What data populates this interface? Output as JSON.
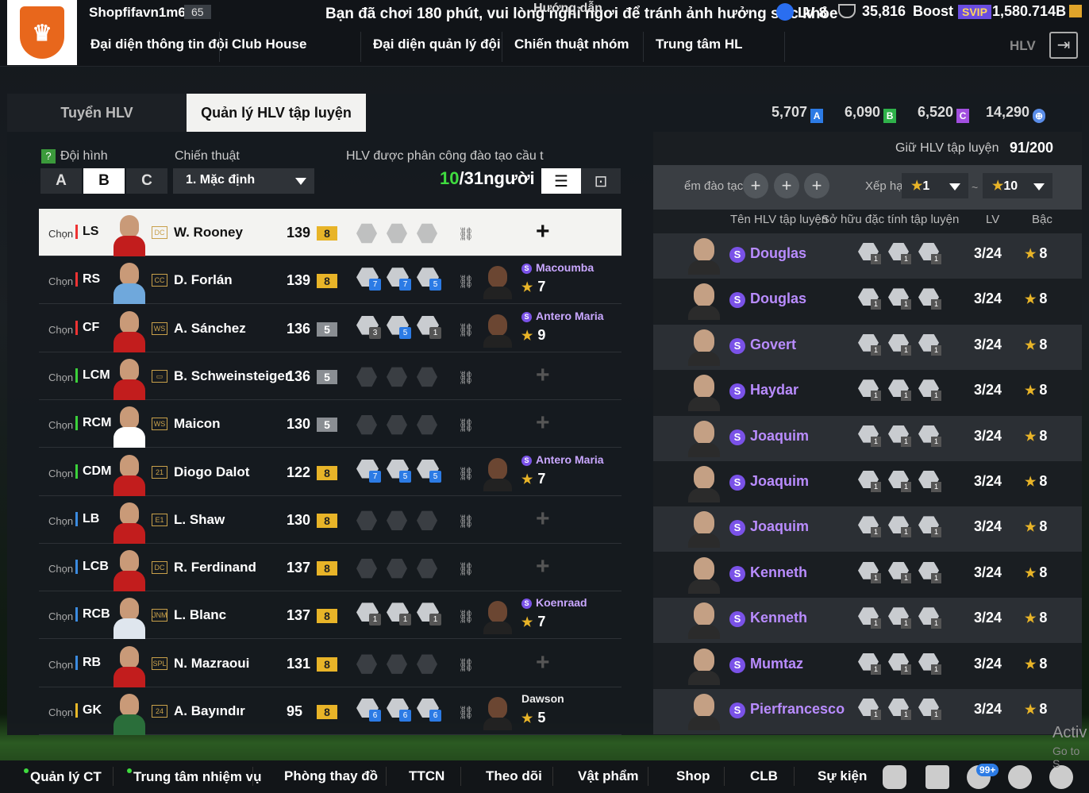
{
  "top": {
    "username": "Shopfifavn1m6",
    "user_level": "65",
    "notice": "Bạn đã chơi 180 phút, vui lòng nghỉ ngơi để tránh ảnh hưởng sức khỏe",
    "guide": "Hướng dẫn",
    "lv": "LV 8",
    "rank_points": "35,816",
    "boost": "Boost",
    "vip": "SVIP",
    "coins": "1,580.714B",
    "hlv": "HLV",
    "crest": "♛"
  },
  "nav": [
    "Đại diện thông tin đội",
    "Club House",
    "Đại diện quản lý đội",
    "Chiến thuật nhóm",
    "Trung tâm HL"
  ],
  "tabs": {
    "recruit": "Tuyển HLV",
    "manage": "Quản lý HLV tập luyện"
  },
  "currencies": [
    {
      "value": "5,707",
      "badge": "A",
      "color": "#2c7be5"
    },
    {
      "value": "6,090",
      "badge": "B",
      "color": "#2fb24a"
    },
    {
      "value": "6,520",
      "badge": "C",
      "color": "#a24fe0"
    },
    {
      "value": "14,290",
      "badge": "⊕",
      "color": "#5a8de8"
    }
  ],
  "left": {
    "squad_label": "Đội hình",
    "q": "?",
    "squads": [
      "A",
      "B",
      "C"
    ],
    "selected_squad": "B",
    "tactic_label": "Chiến thuật",
    "tactic_value": "1. Mặc định",
    "assigned_label": "HLV được phân công đào tạo cầu t",
    "assigned_count": "10",
    "assigned_total": "/31người",
    "list_icon": "list-icon",
    "pitch_icon": "pitch-icon"
  },
  "rows": [
    {
      "chon": "Chọn",
      "pos": "LS",
      "grp": "att",
      "badge": "DC",
      "name": "W. Rooney",
      "ovr": "139",
      "lvl": "8",
      "lvlc": "gold",
      "skills": [],
      "coach": null,
      "hl": true
    },
    {
      "chon": "Chọn",
      "pos": "RS",
      "grp": "att",
      "badge": "CC",
      "name": "D. Forlán",
      "ovr": "139",
      "lvl": "8",
      "lvlc": "gold",
      "skills": [
        "7",
        "7",
        "5"
      ],
      "coach": {
        "name": "Macoumba",
        "stars": "7",
        "s": true
      }
    },
    {
      "chon": "Chọn",
      "pos": "CF",
      "grp": "att",
      "badge": "WS",
      "name": "A. Sánchez",
      "ovr": "136",
      "lvl": "5",
      "lvlc": "grey",
      "skills": [
        "3",
        "5",
        "1"
      ],
      "coach": {
        "name": "Antero Maria",
        "stars": "9",
        "s": true
      }
    },
    {
      "chon": "Chọn",
      "pos": "LCM",
      "grp": "mid",
      "badge": "▭",
      "name": "B. Schweinsteiger",
      "ovr": "136",
      "lvl": "5",
      "lvlc": "grey",
      "skills": [],
      "coach": null
    },
    {
      "chon": "Chọn",
      "pos": "RCM",
      "grp": "mid",
      "badge": "WS",
      "name": "Maicon",
      "ovr": "130",
      "lvl": "5",
      "lvlc": "grey",
      "skills": [],
      "coach": null
    },
    {
      "chon": "Chọn",
      "pos": "CDM",
      "grp": "mid",
      "badge": "21",
      "name": "Diogo Dalot",
      "ovr": "122",
      "lvl": "8",
      "lvlc": "gold",
      "skills": [
        "7",
        "5",
        "5"
      ],
      "coach": {
        "name": "Antero Maria",
        "stars": "7",
        "s": true
      }
    },
    {
      "chon": "Chọn",
      "pos": "LB",
      "grp": "def",
      "badge": "E1",
      "name": "L. Shaw",
      "ovr": "130",
      "lvl": "8",
      "lvlc": "gold",
      "skills": [],
      "coach": null
    },
    {
      "chon": "Chọn",
      "pos": "LCB",
      "grp": "def",
      "badge": "DC",
      "name": "R. Ferdinand",
      "ovr": "137",
      "lvl": "8",
      "lvlc": "gold",
      "skills": [],
      "coach": null
    },
    {
      "chon": "Chọn",
      "pos": "RCB",
      "grp": "def",
      "badge": "JNM",
      "name": "L. Blanc",
      "ovr": "137",
      "lvl": "8",
      "lvlc": "gold",
      "skills": [
        "1",
        "1",
        "1"
      ],
      "coach": {
        "name": "Koenraad",
        "stars": "7",
        "s": true
      }
    },
    {
      "chon": "Chọn",
      "pos": "RB",
      "grp": "def",
      "badge": "SPL",
      "name": "N. Mazraoui",
      "ovr": "131",
      "lvl": "8",
      "lvlc": "gold",
      "skills": [],
      "coach": null
    },
    {
      "chon": "Chọn",
      "pos": "GK",
      "grp": "gk",
      "badge": "24",
      "name": "A. Bayındır",
      "ovr": "95",
      "lvl": "8",
      "lvlc": "gold",
      "skills": [
        "6",
        "6",
        "6"
      ],
      "coach": {
        "name": "Dawson",
        "stars": "5",
        "s": false
      }
    }
  ],
  "right": {
    "keep_label": "Giữ HLV tập luyện",
    "keep_value": "91/200",
    "filter_label": "ểm đào tạc",
    "rank_label": "Xếp hạ",
    "rank_from": "1",
    "rank_to": "10",
    "tilde": "~",
    "col_name": "Tên HLV tập luyện",
    "col_skills": "Sở hữu đặc tính tập luyện",
    "col_lv": "LV",
    "col_rank": "Bậc",
    "coaches": [
      {
        "name": "Douglas",
        "lv": "3/24",
        "rank": "8"
      },
      {
        "name": "Douglas",
        "lv": "3/24",
        "rank": "8"
      },
      {
        "name": "Govert",
        "lv": "3/24",
        "rank": "8"
      },
      {
        "name": "Haydar",
        "lv": "3/24",
        "rank": "8"
      },
      {
        "name": "Joaquim",
        "lv": "3/24",
        "rank": "8"
      },
      {
        "name": "Joaquim",
        "lv": "3/24",
        "rank": "8"
      },
      {
        "name": "Joaquim",
        "lv": "3/24",
        "rank": "8"
      },
      {
        "name": "Kenneth",
        "lv": "3/24",
        "rank": "8"
      },
      {
        "name": "Kenneth",
        "lv": "3/24",
        "rank": "8"
      },
      {
        "name": "Mumtaz",
        "lv": "3/24",
        "rank": "8"
      },
      {
        "name": "Pierfrancesco",
        "lv": "3/24",
        "rank": "8"
      }
    ]
  },
  "bottom": {
    "items": [
      "Quản lý CT",
      "Trung tâm nhiệm vụ",
      "Phòng thay đồ",
      "TTCN",
      "Theo dõi",
      "Vật phẩm",
      "Shop",
      "CLB",
      "Sự kiện"
    ],
    "notif": "99+",
    "activ": "Activ",
    "activ2": "Go to S"
  }
}
